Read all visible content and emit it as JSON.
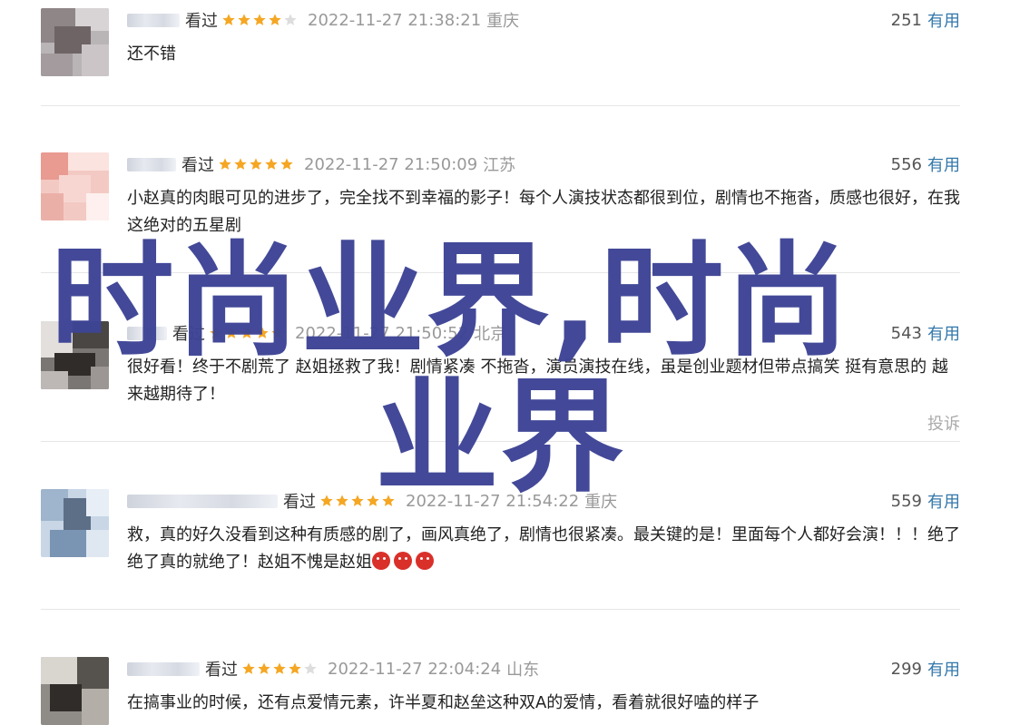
{
  "reviews": [
    {
      "username": "",
      "watched": "看过",
      "rating": 4,
      "time": "2022-11-27 21:38:21",
      "location": "重庆",
      "votes": "251",
      "vote_label": "有用",
      "content": "还不错"
    },
    {
      "username": "",
      "watched": "看过",
      "rating": 5,
      "time": "2022-11-27 21:50:09",
      "location": "江苏",
      "votes": "556",
      "vote_label": "有用",
      "content": "小赵真的肉眼可见的进步了，完全找不到幸福的影子！每个人演技状态都很到位，剧情也不拖沓，质感也很好，在我这绝对的五星剧"
    },
    {
      "username": "",
      "watched": "看过",
      "rating": 5,
      "time": "2022-11-27 21:50:52",
      "location": "北京",
      "votes": "543",
      "vote_label": "有用",
      "content": "很好看！终于不剧荒了 赵姐拯救了我！剧情紧凑 不拖沓，演员演技在线，虽是创业题材但带点搞笑 挺有意思的 越来越期待了！",
      "report": "投诉"
    },
    {
      "username": "",
      "watched": "看过",
      "rating": 5,
      "time": "2022-11-27 21:54:22",
      "location": "重庆",
      "votes": "559",
      "vote_label": "有用",
      "content": "救，真的好久没看到这种有质感的剧了，画风真绝了，剧情也很紧凑。最关键的是！里面每个人都好会演！！！绝了绝了真的就绝了！赵姐不愧是赵姐",
      "emoji_count": 3
    },
    {
      "username": "",
      "watched": "看过",
      "rating": 4,
      "time": "2022-11-27 22:04:24",
      "location": "山东",
      "votes": "299",
      "vote_label": "有用",
      "content": "在搞事业的时候，还有点爱情元素，许半夏和赵垒这种双A的爱情，看着就很好嗑的样子"
    }
  ],
  "overlay": {
    "line1": "时尚业界,时尚",
    "line2": "业界"
  },
  "colors": {
    "star": "#f5a623",
    "star_empty": "#dddddd",
    "vote_link": "#3377aa",
    "overlay": "#3d4495"
  }
}
